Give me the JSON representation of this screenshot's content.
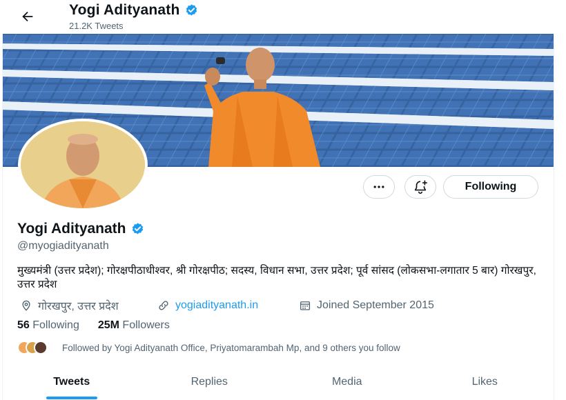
{
  "header": {
    "back_icon": "arrow-left-icon",
    "name": "Yogi Adityanath",
    "tweet_count": "21.2K Tweets"
  },
  "profile": {
    "name": "Yogi Adityanath",
    "handle": "@myogiadityanath",
    "verified_icon": "verified-badge-icon",
    "bio": "मुख्यमंत्री (उत्तर प्रदेश); गोरक्षपीठाधीश्वर, श्री गोरक्षपीठ; सदस्य, विधान सभा, उत्तर प्रदेश; पूर्व सांसद (लोकसभा-लगातार 5 बार) गोरखपुर, उत्तर प्रदेश",
    "location": "गोरखपुर, उत्तर प्रदेश",
    "website": "yogiadityanath.in",
    "joined": "Joined September 2015"
  },
  "actions": {
    "more_icon": "more-dots-icon",
    "notify_icon": "bell-plus-icon",
    "following_label": "Following"
  },
  "stats": {
    "following_count": "56",
    "following_label": "Following",
    "followers_count": "25M",
    "followers_label": "Followers"
  },
  "followed_by": "Followed by Yogi Adityanath Office, Priyatomarambah Mp, and 9 others you follow",
  "tabs": [
    {
      "label": "Tweets",
      "active": true
    },
    {
      "label": "Replies",
      "active": false
    },
    {
      "label": "Media",
      "active": false
    },
    {
      "label": "Likes",
      "active": false
    }
  ],
  "colors": {
    "accent": "#1d9bf0",
    "text": "#0f1419",
    "secondary": "#536471",
    "border": "#cfd9de"
  }
}
